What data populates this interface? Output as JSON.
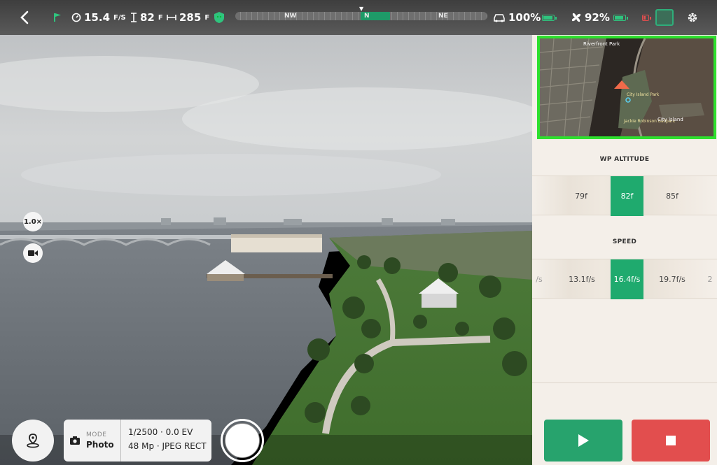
{
  "telemetry": {
    "back_icon": "chevron-left-icon",
    "speed_value": "15.4",
    "speed_unit": "F/S",
    "altitude_value": "82",
    "altitude_unit": "F",
    "distance_value": "285",
    "distance_unit": "F",
    "vehicle_battery": "100%",
    "aircraft_battery": "92%",
    "colors": {
      "accent": "#1faa6e",
      "danger": "#e24e4e",
      "map_border": "#2ee02e"
    }
  },
  "compass": {
    "left": "NW",
    "center": "N",
    "right": "NE"
  },
  "camera": {
    "zoom_label": "1.0×",
    "mode_label": "MODE",
    "mode_value": "Photo",
    "exposure": "1/2500 · 0.0 EV",
    "format": "48 Mp · JPEG RECT"
  },
  "minimap": {
    "labels": [
      "Riverfront Park",
      "City Island Park",
      "Jackie Robinson Ballpark",
      "City Island"
    ]
  },
  "waypoint": {
    "altitude_title": "WP ALTITUDE",
    "altitude_values": [
      "79f",
      "82f",
      "85f"
    ],
    "speed_title": "SPEED",
    "speed_values": [
      "/s",
      "13.1f/s",
      "16.4f/s",
      "19.7f/s",
      "2"
    ]
  }
}
